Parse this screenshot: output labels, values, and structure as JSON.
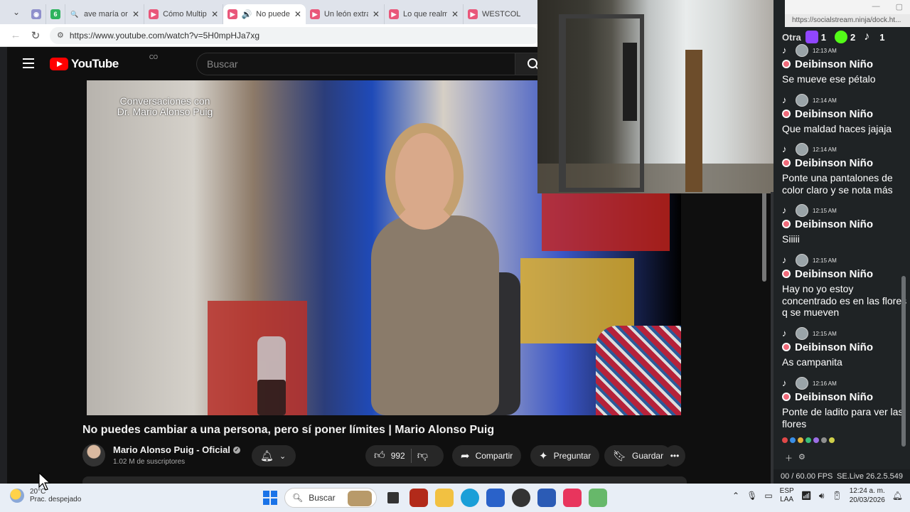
{
  "browser": {
    "tabs": [
      {
        "title": "",
        "fav_color": "#8f8fcc",
        "fav_char": "◉"
      },
      {
        "title": "",
        "fav_color": "#2db35d",
        "fav_char": "6"
      },
      {
        "title": "ave maría orac",
        "fav_color": "#1a73e8",
        "fav_char": "🔍"
      },
      {
        "title": "Cómo Multipli",
        "fav_color": "#e9577a",
        "fav_char": "▶"
      },
      {
        "title": "No puede",
        "fav_color": "#e9577a",
        "fav_char": "🔊",
        "active": true
      },
      {
        "title": "Un león extra",
        "fav_color": "#e9577a",
        "fav_char": "▶"
      },
      {
        "title": "Lo que realme",
        "fav_color": "#e9577a",
        "fav_char": "▶"
      },
      {
        "title": "WESTCOL",
        "fav_color": "#e9577a",
        "fav_char": "▶"
      }
    ],
    "url": "https://www.youtube.com/watch?v=5H0mpHJa7xg"
  },
  "youtube": {
    "logo_text": "YouTube",
    "country": "CO",
    "search_placeholder": "Buscar",
    "video_caption_line1": "Conversaciones con",
    "video_caption_line2": "Dr. Mario Alonso Puig",
    "title": "No puedes cambiar a una persona, pero sí poner límites | Mario Alonso Puig",
    "channel_name": "Mario Alonso Puig - Oficial",
    "subscribers": "1.02 M de suscriptores",
    "likes": "992",
    "share_label": "Compartir",
    "ask_label": "Preguntar",
    "save_label": "Guardar"
  },
  "chat_panel": {
    "url": "https://socialstream.ninja/dock.ht...",
    "counts_prefix": "Otra",
    "twitch_count": "1",
    "kick_count": "2",
    "tiktok_count": "1",
    "messages": [
      {
        "time": "12:13 AM",
        "user": "Deibinson Niño",
        "text": "Se mueve ese pétalo"
      },
      {
        "time": "12:14 AM",
        "user": "Deibinson Niño",
        "text": "Que maldad haces jajaja"
      },
      {
        "time": "12:14 AM",
        "user": "Deibinson Niño",
        "text": "Ponte una pantalones de color claro y se nota más"
      },
      {
        "time": "12:15 AM",
        "user": "Deibinson Niño",
        "text": "Siiiii"
      },
      {
        "time": "12:15 AM",
        "user": "Deibinson Niño",
        "text": "Hay no yo estoy concentrado es en las flores q se mueven"
      },
      {
        "time": "12:15 AM",
        "user": "Deibinson Niño",
        "text": "As campanita"
      },
      {
        "time": "12:16 AM",
        "user": "Deibinson Niño",
        "text": "Ponte de ladito para ver las flores"
      }
    ],
    "fps": "00 / 60.00 FPS",
    "version": "SE.Live 26.2.5.549"
  },
  "taskbar": {
    "temperature": "20°C",
    "weather": "Prac. despejado",
    "search": "Buscar",
    "lang1": "ESP",
    "lang2": "LAA",
    "time": "12:24 a. m.",
    "date": "20/03/2026"
  }
}
